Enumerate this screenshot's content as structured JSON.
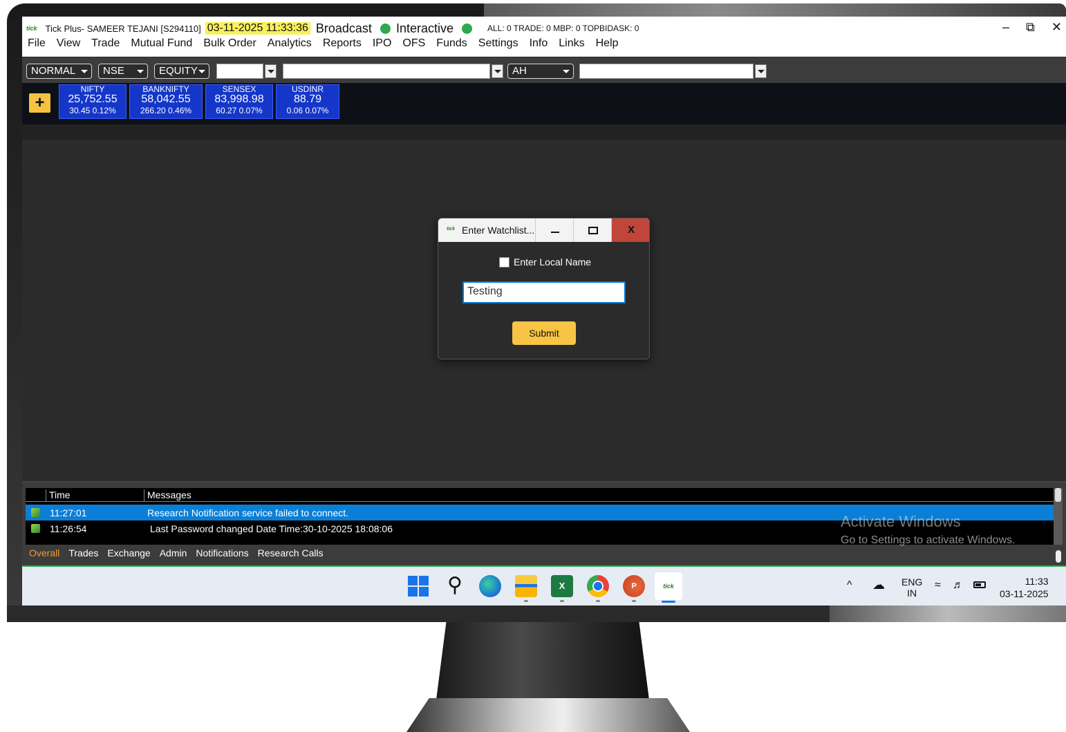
{
  "window": {
    "app_logo": "tick",
    "title": "Tick Plus- SAMEER TEJANI [S294110]",
    "datetime": "03-11-2025 11:33:36",
    "broadcast_label": "Broadcast",
    "interactive_label": "Interactive",
    "counts": "ALL: 0  TRADE: 0  MBP: 0  TOPBIDASK: 0",
    "status_dot_color": "#2fa84f",
    "controls": {
      "minimize": "–",
      "restore": "⧉",
      "close": "✕"
    }
  },
  "menu": [
    "File",
    "View",
    "Trade",
    "Mutual Fund",
    "Bulk Order",
    "Analytics",
    "Reports",
    "IPO",
    "OFS",
    "Funds",
    "Settings",
    "Info",
    "Links",
    "Help"
  ],
  "toolbar": {
    "mode": "NORMAL",
    "exchange": "NSE",
    "segment": "EQUITY",
    "symbol_input": "",
    "search_input": "",
    "filter": "AH",
    "extra_input": ""
  },
  "tickers": [
    {
      "name": "NIFTY",
      "price": "25,752.55",
      "change": "30.45  0.12%"
    },
    {
      "name": "BANKNIFTY",
      "price": "58,042.55",
      "change": "266.20  0.46%"
    },
    {
      "name": "SENSEX",
      "price": "83,998.98",
      "change": "60.27  0.07%"
    },
    {
      "name": "USDINR",
      "price": "88.79",
      "change": "0.06  0.07%"
    }
  ],
  "add_ticker_label": "+",
  "dialog": {
    "title": "Enter Watchlist...",
    "icon": "tick",
    "minimize": "",
    "maximize": "",
    "close": "X",
    "checkbox_label": "Enter Local Name",
    "checkbox_checked": false,
    "input_value": "Testing",
    "submit_label": "Submit"
  },
  "messages": {
    "headers": {
      "time": "Time",
      "message": "Messages"
    },
    "rows": [
      {
        "time": "11:27:01",
        "message": "Research Notification service failed to connect.",
        "selected": true
      },
      {
        "time": "11:26:54",
        "message": "Last Password changed Date Time:30-10-2025 18:08:06",
        "selected": false
      }
    ],
    "tabs": [
      "Overall",
      "Trades",
      "Exchange",
      "Admin",
      "Notifications",
      "Research Calls"
    ],
    "active_tab": "Overall"
  },
  "watermark": {
    "line1": "Activate Windows",
    "line2": "Go to Settings to activate Windows."
  },
  "taskbar": {
    "icons": [
      "start-icon",
      "search-icon",
      "edge-icon",
      "files-icon",
      "excel-icon",
      "chrome-icon",
      "powerpoint-icon",
      "tick-app-icon"
    ],
    "excel_glyph": "X",
    "ppt_glyph": "P",
    "tick_glyph": "tick",
    "search_glyph": "⚲",
    "tray": {
      "chevron": "^",
      "lang_line1": "ENG",
      "lang_line2": "IN",
      "time": "11:33",
      "date": "03-11-2025"
    }
  }
}
